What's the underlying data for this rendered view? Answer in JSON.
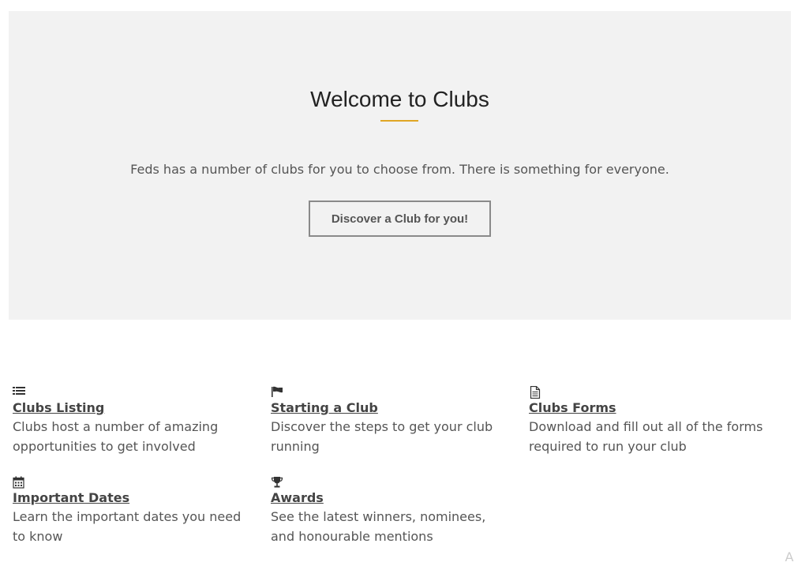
{
  "hero": {
    "title": "Welcome to Clubs",
    "description": "Feds has a number of clubs for you to choose from. There is something for everyone.",
    "button_label": "Discover a Club for you!",
    "accent_color": "#e0a625"
  },
  "features": [
    {
      "icon": "list-icon",
      "title": "Clubs Listing",
      "description": "Clubs host a number of amazing opportunities to get involved"
    },
    {
      "icon": "flag-icon",
      "title": "Starting a Club",
      "description": "Discover the steps to get your club running"
    },
    {
      "icon": "document-icon",
      "title": "Clubs Forms",
      "description": "Download and fill out all of the forms required to run your club"
    },
    {
      "icon": "calendar-icon",
      "title": "Important Dates",
      "description": "Learn the important dates you need to know"
    },
    {
      "icon": "trophy-icon",
      "title": "Awards",
      "description": "See the latest winners, nominees, and honourable mentions"
    }
  ],
  "corner_glyph": "A"
}
